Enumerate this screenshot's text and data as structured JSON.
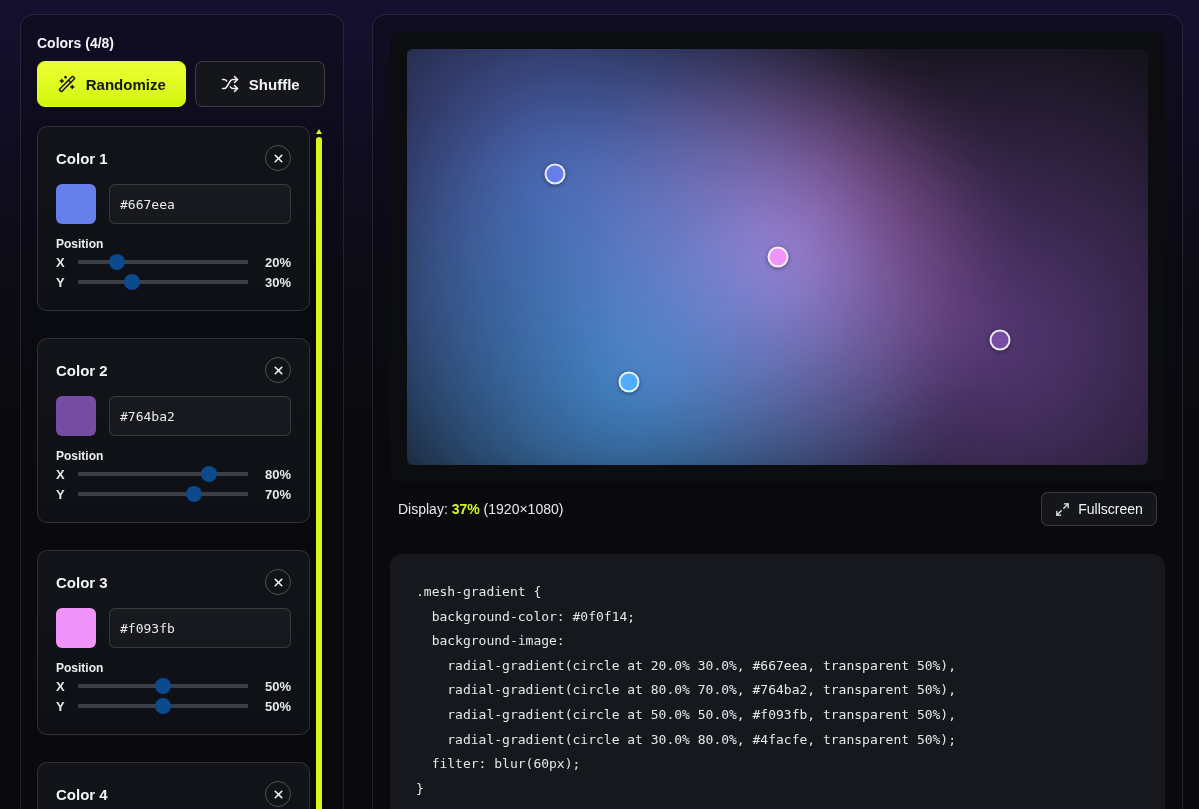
{
  "panel": {
    "title": "Colors (4/8)"
  },
  "actions": [
    {
      "kind": "primary",
      "label": "Randomize"
    },
    {
      "kind": "secondary",
      "label": "Shuffle"
    }
  ],
  "colors": [
    {
      "title": "Color 1",
      "color": "#667eea",
      "hex": "#667eea",
      "position_label": "Position",
      "sliders": [
        {
          "axis": "X",
          "level": 0.2,
          "reading": "20%"
        },
        {
          "axis": "Y",
          "level": 0.3,
          "reading": "30%"
        }
      ]
    },
    {
      "title": "Color 2",
      "color": "#764ba2",
      "hex": "#764ba2",
      "position_label": "Position",
      "sliders": [
        {
          "axis": "X",
          "level": 0.8,
          "reading": "80%"
        },
        {
          "axis": "Y",
          "level": 0.7,
          "reading": "70%"
        }
      ]
    },
    {
      "title": "Color 3",
      "color": "#f093fb",
      "hex": "#f093fb",
      "position_label": "Position",
      "sliders": [
        {
          "axis": "X",
          "level": 0.5,
          "reading": "50%"
        },
        {
          "axis": "Y",
          "level": 0.5,
          "reading": "50%"
        }
      ]
    },
    {
      "title": "Color 4"
    }
  ],
  "preview": {
    "handles": [
      {
        "color": "#667eea"
      },
      {
        "color": "#764ba2"
      },
      {
        "color": "#f093fb"
      },
      {
        "color": "#4facfe"
      }
    ]
  },
  "display": {
    "label": "Display:",
    "scale": "37%",
    "resolution": "(1920×1080)"
  },
  "fullscreen": {
    "label": "Fullscreen"
  },
  "code": [
    {
      "text": ".mesh-gradient {",
      "children": [
        {
          "text": "background-color: #0f0f14;"
        },
        {
          "text": "background-image:",
          "children": [
            {
              "text": "radial-gradient(circle at 20.0% 30.0%, #667eea, transparent 50%),"
            },
            {
              "text": "radial-gradient(circle at 80.0% 70.0%, #764ba2, transparent 50%),"
            },
            {
              "text": "radial-gradient(circle at 50.0% 50.0%, #f093fb, transparent 50%),"
            },
            {
              "text": "radial-gradient(circle at 30.0% 80.0%, #4facfe, transparent 50%);"
            }
          ]
        },
        {
          "text": "filter: blur(60px);"
        }
      ]
    },
    {
      "text": "}"
    }
  ]
}
